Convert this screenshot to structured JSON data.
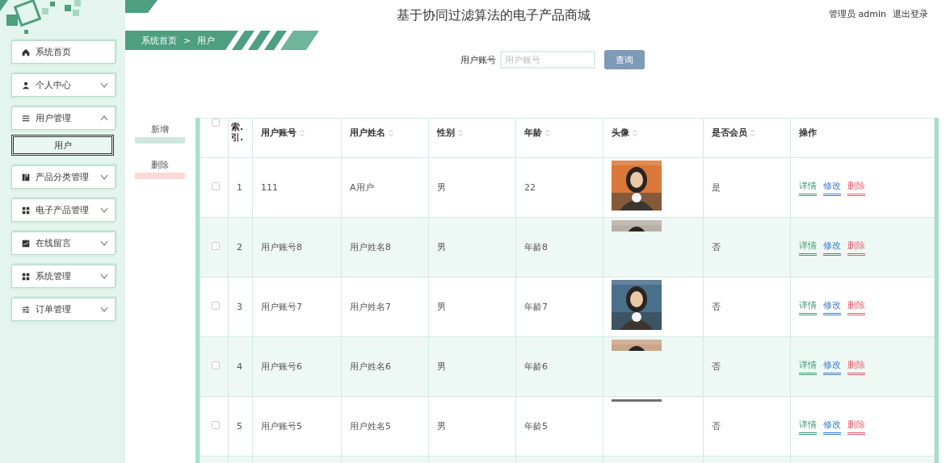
{
  "header": {
    "title": "基于协同过滤算法的电子产品商城",
    "user": "管理员 admin",
    "logout": "退出登录"
  },
  "breadcrumb": {
    "home": "系统首页",
    "separator": ">",
    "current": "用户"
  },
  "sidebar": {
    "items": [
      {
        "label": "系统首页",
        "kind": "link"
      },
      {
        "label": "个人中心",
        "kind": "group",
        "expanded": false
      },
      {
        "label": "用户管理",
        "kind": "group",
        "expanded": true,
        "children": [
          {
            "label": "用户",
            "selected": true
          }
        ]
      },
      {
        "label": "产品分类管理",
        "kind": "group",
        "expanded": false
      },
      {
        "label": "电子产品管理",
        "kind": "group",
        "expanded": false
      },
      {
        "label": "在线留言",
        "kind": "group",
        "expanded": false
      },
      {
        "label": "系统管理",
        "kind": "group",
        "expanded": false
      },
      {
        "label": "订单管理",
        "kind": "group",
        "expanded": false
      }
    ]
  },
  "search": {
    "label": "用户账号",
    "placeholder": "用户账号",
    "button": "查询"
  },
  "actions": [
    {
      "label": "新增",
      "color": "#cfe6df"
    },
    {
      "label": "删除",
      "color": "#fcd9d6"
    }
  ],
  "table": {
    "select_all_checked": false,
    "columns": [
      {
        "label": "索.引.",
        "sortable": false
      },
      {
        "label": "用户账号",
        "sortable": true
      },
      {
        "label": "用户姓名",
        "sortable": true
      },
      {
        "label": "性别",
        "sortable": true
      },
      {
        "label": "年龄",
        "sortable": true
      },
      {
        "label": "头像",
        "sortable": true
      },
      {
        "label": "是否会员",
        "sortable": true
      },
      {
        "label": "操作",
        "sortable": false
      }
    ],
    "rows": [
      {
        "checked": false,
        "index": "1",
        "account": "111",
        "name": "A用户",
        "gender": "男",
        "age": "22",
        "avatar": {
          "kind": "full"
        },
        "member": "是",
        "actions": [
          {
            "label": "详情",
            "color": "#3f9a78"
          },
          {
            "label": "修改",
            "color": "#3f7fc8"
          },
          {
            "label": "删除",
            "color": "#e0606e"
          }
        ]
      },
      {
        "checked": false,
        "index": "2",
        "account": "用户账号8",
        "name": "用户姓名8",
        "gender": "男",
        "age": "年龄8",
        "avatar": {
          "kind": "strip"
        },
        "member": "否",
        "actions": [
          {
            "label": "详情",
            "color": "#3f9a78"
          },
          {
            "label": "修改",
            "color": "#3f7fc8"
          },
          {
            "label": "删除",
            "color": "#e0606e"
          }
        ]
      },
      {
        "checked": false,
        "index": "3",
        "account": "用户账号7",
        "name": "用户姓名7",
        "gender": "男",
        "age": "年龄7",
        "avatar": {
          "kind": "full"
        },
        "member": "否",
        "actions": [
          {
            "label": "详情",
            "color": "#3f9a78"
          },
          {
            "label": "修改",
            "color": "#3f7fc8"
          },
          {
            "label": "删除",
            "color": "#e0606e"
          }
        ]
      },
      {
        "checked": false,
        "index": "4",
        "account": "用户账号6",
        "name": "用户姓名6",
        "gender": "男",
        "age": "年龄6",
        "avatar": {
          "kind": "strip"
        },
        "member": "否",
        "actions": [
          {
            "label": "详情",
            "color": "#3f9a78"
          },
          {
            "label": "修改",
            "color": "#3f7fc8"
          },
          {
            "label": "删除",
            "color": "#e0606e"
          }
        ]
      },
      {
        "checked": false,
        "index": "5",
        "account": "用户账号5",
        "name": "用户姓名5",
        "gender": "男",
        "age": "年龄5",
        "avatar": {
          "kind": "line"
        },
        "member": "否",
        "actions": [
          {
            "label": "详情",
            "color": "#3f9a78"
          },
          {
            "label": "修改",
            "color": "#3f7fc8"
          },
          {
            "label": "删除",
            "color": "#e0606e"
          }
        ]
      }
    ]
  }
}
